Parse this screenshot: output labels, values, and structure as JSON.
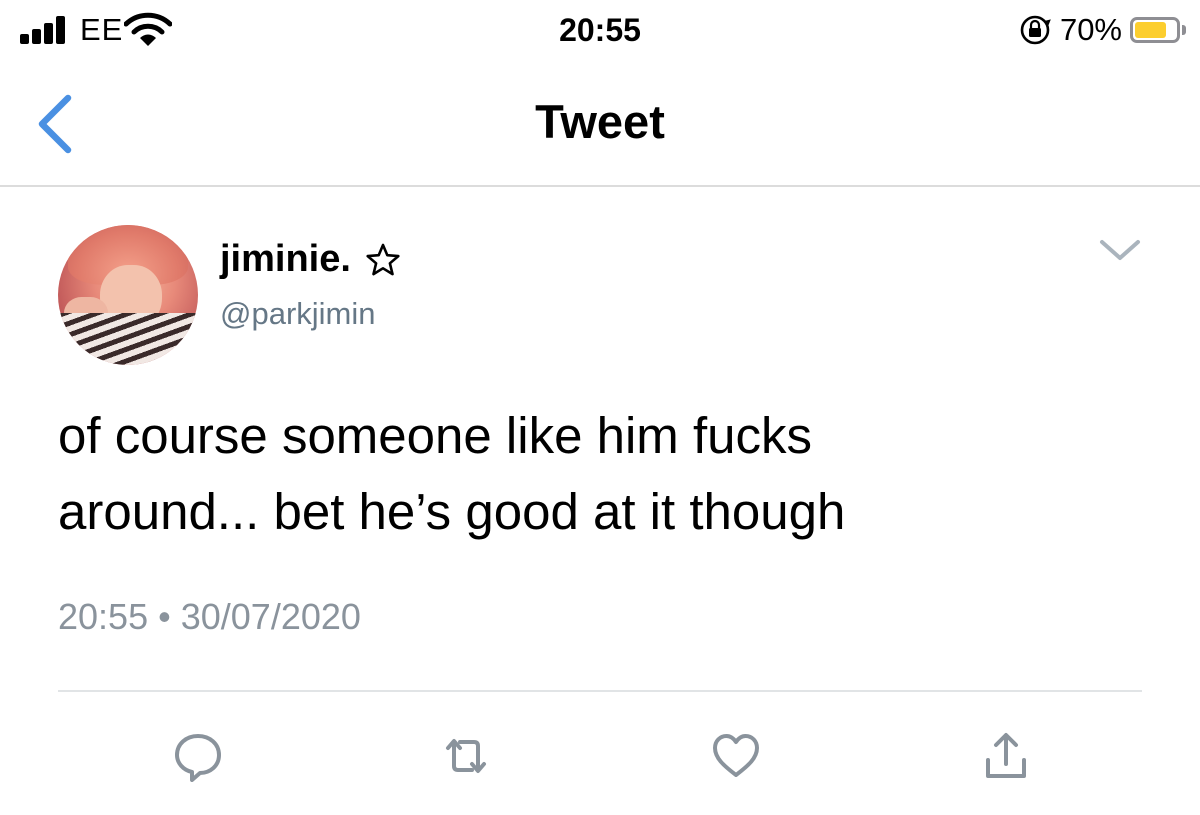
{
  "status_bar": {
    "carrier": "EE",
    "time": "20:55",
    "battery_percent": "70%",
    "battery_level": 0.7,
    "battery_color": "#fcce2e",
    "icons": [
      "signal-icon",
      "wifi-icon",
      "orientation-lock-icon",
      "battery-icon"
    ]
  },
  "nav": {
    "title": "Tweet",
    "back_icon": "chevron-left-icon",
    "accent_color": "#4a90e2"
  },
  "tweet": {
    "display_name": "jiminie.",
    "name_icon": "star-outline-icon",
    "handle": "@parkjimin",
    "text": "of course someone like him fucks\naround... bet he’s good at it though",
    "time": "20:55",
    "separator": "•",
    "date": "30/07/2020",
    "menu_icon": "chevron-down-icon"
  },
  "actions": [
    {
      "name": "reply",
      "icon": "reply-icon"
    },
    {
      "name": "retweet",
      "icon": "retweet-icon"
    },
    {
      "name": "like",
      "icon": "heart-icon"
    },
    {
      "name": "share",
      "icon": "share-icon"
    }
  ],
  "colors": {
    "secondary_text": "#657786",
    "meta_text": "#8a939c",
    "action_icon": "#8a939c"
  }
}
